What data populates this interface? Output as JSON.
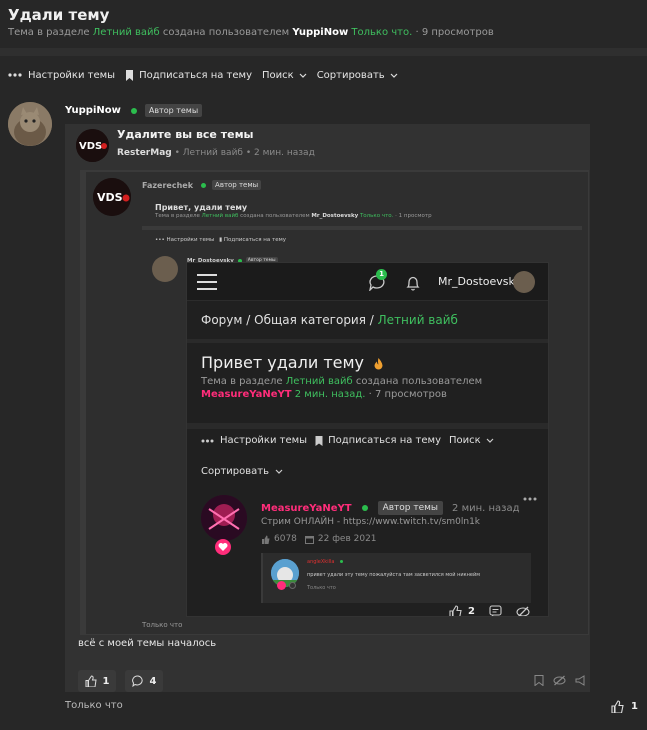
{
  "thread": {
    "title": "Удали тему",
    "meta_prefix": "Тема в разделе",
    "section": "Летний вайб",
    "created_by": "создана пользователем",
    "author": "YuppiNow",
    "time": "Только что.",
    "views": "· 9 просмотров"
  },
  "toolbar": {
    "settings": "Настройки темы",
    "subscribe": "Подписаться на тему",
    "search": "Поиск",
    "sort": "Сортировать"
  },
  "post": {
    "author": "YuppiNow",
    "badge": "Автор темы",
    "text": "всё с моей темы началось",
    "likes": "1",
    "replies": "4",
    "time": "Только что",
    "score": "1"
  },
  "quote1": {
    "title": "Удалите вы все темы",
    "author": "ResterMag",
    "section": "Летний вайб",
    "time": "2 мин. назад"
  },
  "quote2": {
    "author": "Fazerechek",
    "badge": "Автор темы",
    "title": "Привет, удали тему",
    "meta_prefix": "Тема в разделе",
    "section": "Летний вайб",
    "created_by": "создана пользователем",
    "creator": "Mr_Dostoevsky",
    "time": "Только что.",
    "views": "· 1 просмотр",
    "toolbar_settings": "Настройки темы",
    "toolbar_subscribe": "Подписаться на тему",
    "inner_author": "Mr_Dostoevsky",
    "inner_badge": "Автор темы",
    "footer_time": "Только что"
  },
  "screenshot": {
    "notif_count": "1",
    "username": "Mr_Dostoevsky",
    "crumb_forum": "Форум",
    "crumb_sep1": "/",
    "crumb_category": "Общая категория",
    "crumb_sep2": "/",
    "crumb_section": "Летний вайб",
    "title": "Привет удали тему",
    "meta_prefix": "Тема в разделе",
    "section": "Летний вайб",
    "created_by": "создана пользователем",
    "creator": "MeasureYaNeYT",
    "time": "2 мин. назад.",
    "views": "· 7 просмотров",
    "settings": "Настройки темы",
    "subscribe": "Подписаться на тему",
    "search": "Поиск",
    "sort": "Сортировать",
    "post_author": "MeasureYaNeYT",
    "post_badge": "Автор темы",
    "post_time": "2 мин. назад",
    "post_text": "Стрим ОНЛАЙН - https://www.twitch.tv/sm0ln1k",
    "stat_count": "6078",
    "stat_date": "22 фев 2021",
    "inner_author": "angleXkilla",
    "inner_text": "привет удали эту тему пожалуйста там засветился мой никнейм",
    "inner_time": "Только что",
    "like_count": "2"
  },
  "colors": {
    "accent_green": "#3fbf5f",
    "accent_pink": "#ff2d7a",
    "online_dot": "#2bbd4d",
    "background": "#272727"
  }
}
